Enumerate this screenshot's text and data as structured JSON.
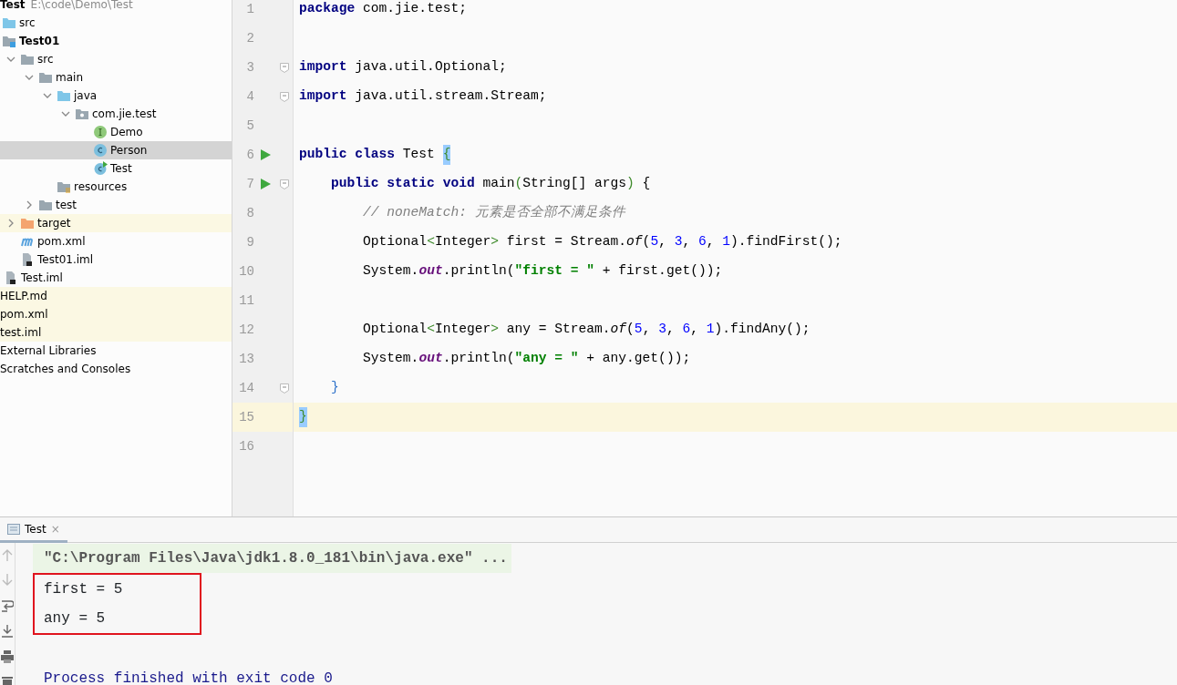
{
  "project_tree": {
    "root": {
      "label": "Test",
      "path": "E:\\code\\Demo\\Test"
    },
    "items": [
      {
        "label": "src",
        "kind": "source-folder",
        "bold": false,
        "selected": false,
        "ignored": false
      },
      {
        "label": "Test01",
        "kind": "module",
        "bold": true,
        "selected": false,
        "ignored": false,
        "children": [
          {
            "label": "src",
            "kind": "folder",
            "bold": false,
            "selected": false,
            "ignored": false,
            "expanded": true,
            "children": [
              {
                "label": "main",
                "kind": "folder",
                "bold": false,
                "selected": false,
                "ignored": false,
                "expanded": true,
                "children": [
                  {
                    "label": "java",
                    "kind": "source-folder",
                    "bold": false,
                    "selected": false,
                    "ignored": false,
                    "expanded": true,
                    "children": [
                      {
                        "label": "com.jie.test",
                        "kind": "package",
                        "bold": false,
                        "selected": false,
                        "ignored": false,
                        "expanded": true,
                        "children": [
                          {
                            "label": "Demo",
                            "kind": "interface",
                            "bold": false,
                            "selected": false,
                            "ignored": false
                          },
                          {
                            "label": "Person",
                            "kind": "class",
                            "bold": false,
                            "selected": true,
                            "ignored": false
                          },
                          {
                            "label": "Test",
                            "kind": "runnable-class",
                            "bold": false,
                            "selected": false,
                            "ignored": false
                          }
                        ]
                      }
                    ]
                  },
                  {
                    "label": "resources",
                    "kind": "resources",
                    "bold": false,
                    "selected": false,
                    "ignored": false
                  }
                ]
              },
              {
                "label": "test",
                "kind": "folder",
                "bold": false,
                "selected": false,
                "ignored": false,
                "expanded": false
              }
            ]
          },
          {
            "label": "target",
            "kind": "excluded-folder",
            "bold": false,
            "selected": false,
            "ignored": true,
            "expanded": false
          },
          {
            "label": "pom.xml",
            "kind": "maven",
            "bold": false,
            "selected": false,
            "ignored": false
          },
          {
            "label": "Test01.iml",
            "kind": "iml",
            "bold": false,
            "selected": false,
            "ignored": false
          }
        ]
      },
      {
        "label": "Test.iml",
        "kind": "iml",
        "bold": false,
        "selected": false,
        "ignored": false
      },
      {
        "label": "HELP.md",
        "kind": "file",
        "bold": false,
        "selected": false,
        "ignored": true
      },
      {
        "label": "pom.xml",
        "kind": "file",
        "bold": false,
        "selected": false,
        "ignored": true
      },
      {
        "label": "test.iml",
        "kind": "file",
        "bold": false,
        "selected": false,
        "ignored": true
      },
      {
        "label": "External Libraries",
        "kind": "file",
        "bold": false,
        "selected": false,
        "ignored": false
      },
      {
        "label": "Scratches and Consoles",
        "kind": "file",
        "bold": false,
        "selected": false,
        "ignored": false
      }
    ]
  },
  "editor": {
    "lines": [
      {
        "number": "1",
        "current": false,
        "run": false,
        "fold": false,
        "tokens": [
          {
            "kind": "kw",
            "text": "package"
          },
          {
            "kind": "plain",
            "text": " com.jie.test;"
          }
        ]
      },
      {
        "number": "2",
        "current": false,
        "run": false,
        "fold": false
      },
      {
        "number": "3",
        "current": false,
        "run": false,
        "fold": true,
        "tokens": [
          {
            "kind": "kw",
            "text": "import"
          },
          {
            "kind": "plain",
            "text": " java.util.Optional;"
          }
        ]
      },
      {
        "number": "4",
        "current": false,
        "run": false,
        "fold": true,
        "tokens": [
          {
            "kind": "kw",
            "text": "import"
          },
          {
            "kind": "plain",
            "text": " java.util.stream.Stream;"
          }
        ]
      },
      {
        "number": "5",
        "current": false,
        "run": false,
        "fold": false
      },
      {
        "number": "6",
        "current": false,
        "run": true,
        "fold": false,
        "tokens": [
          {
            "kind": "kw",
            "text": "public class"
          },
          {
            "kind": "plain",
            "text": " Test "
          },
          {
            "kind": "brace",
            "text": "{",
            "matched": true
          }
        ]
      },
      {
        "number": "7",
        "current": false,
        "run": true,
        "fold": true,
        "tokens": [
          {
            "kind": "kw",
            "text": "    public static void"
          },
          {
            "kind": "plain",
            "text": " main"
          },
          {
            "kind": "brace",
            "text": "(",
            "matched": false
          },
          {
            "kind": "plain",
            "text": "String[] args"
          },
          {
            "kind": "brace",
            "text": ")",
            "matched": false
          },
          {
            "kind": "plain",
            "text": " {"
          }
        ]
      },
      {
        "number": "8",
        "current": false,
        "run": false,
        "fold": false,
        "tokens": [
          {
            "kind": "comment",
            "text": "        // noneMatch: 元素是否全部不满足条件"
          }
        ]
      },
      {
        "number": "9",
        "current": false,
        "run": false,
        "fold": false,
        "tokens": [
          {
            "kind": "plain",
            "text": "        Optional"
          },
          {
            "kind": "brace",
            "text": "<",
            "matched": false
          },
          {
            "kind": "plain",
            "text": "Integer"
          },
          {
            "kind": "brace",
            "text": ">",
            "matched": false
          },
          {
            "kind": "plain",
            "text": " first = Stream."
          },
          {
            "kind": "method",
            "text": "of"
          },
          {
            "kind": "plain",
            "text": "("
          },
          {
            "kind": "num",
            "text": "5"
          },
          {
            "kind": "plain",
            "text": ", "
          },
          {
            "kind": "num",
            "text": "3"
          },
          {
            "kind": "plain",
            "text": ", "
          },
          {
            "kind": "num",
            "text": "6"
          },
          {
            "kind": "plain",
            "text": ", "
          },
          {
            "kind": "num",
            "text": "1"
          },
          {
            "kind": "plain",
            "text": ").findFirst();"
          }
        ]
      },
      {
        "number": "10",
        "current": false,
        "run": false,
        "fold": false,
        "tokens": [
          {
            "kind": "plain",
            "text": "        System."
          },
          {
            "kind": "field",
            "text": "out"
          },
          {
            "kind": "plain",
            "text": ".println("
          },
          {
            "kind": "str",
            "text": "\"first = \""
          },
          {
            "kind": "plain",
            "text": " + first.get());"
          }
        ]
      },
      {
        "number": "11",
        "current": false,
        "run": false,
        "fold": false
      },
      {
        "number": "12",
        "current": false,
        "run": false,
        "fold": false,
        "tokens": [
          {
            "kind": "plain",
            "text": "        Optional"
          },
          {
            "kind": "brace",
            "text": "<",
            "matched": false
          },
          {
            "kind": "plain",
            "text": "Integer"
          },
          {
            "kind": "brace",
            "text": ">",
            "matched": false
          },
          {
            "kind": "plain",
            "text": " any = Stream."
          },
          {
            "kind": "method",
            "text": "of"
          },
          {
            "kind": "plain",
            "text": "("
          },
          {
            "kind": "num",
            "text": "5"
          },
          {
            "kind": "plain",
            "text": ", "
          },
          {
            "kind": "num",
            "text": "3"
          },
          {
            "kind": "plain",
            "text": ", "
          },
          {
            "kind": "num",
            "text": "6"
          },
          {
            "kind": "plain",
            "text": ", "
          },
          {
            "kind": "num",
            "text": "1"
          },
          {
            "kind": "plain",
            "text": ").findAny();"
          }
        ]
      },
      {
        "number": "13",
        "current": false,
        "run": false,
        "fold": false,
        "tokens": [
          {
            "kind": "plain",
            "text": "        System."
          },
          {
            "kind": "field",
            "text": "out"
          },
          {
            "kind": "plain",
            "text": ".println("
          },
          {
            "kind": "str",
            "text": "\"any = \""
          },
          {
            "kind": "plain",
            "text": " + any.get());"
          }
        ]
      },
      {
        "number": "14",
        "current": false,
        "run": false,
        "fold": true,
        "tokens": [
          {
            "kind": "brace2",
            "text": "    }",
            "matched": false
          }
        ]
      },
      {
        "number": "15",
        "current": true,
        "run": false,
        "fold": false,
        "tokens": [
          {
            "kind": "brace",
            "text": "}",
            "matched": true
          }
        ]
      },
      {
        "number": "16",
        "current": false,
        "run": false,
        "fold": false
      }
    ]
  },
  "run_panel": {
    "tab": {
      "label": "Test",
      "close": "×"
    },
    "console": [
      {
        "kind": "command",
        "text": "\"C:\\Program Files\\Java\\jdk1.8.0_181\\bin\\java.exe\" ...",
        "boxed": false
      },
      {
        "kind": "output",
        "text": "first = 5",
        "boxed": true
      },
      {
        "kind": "output",
        "text": "any = 5",
        "boxed": true
      },
      {
        "kind": "blank"
      },
      {
        "kind": "system",
        "text": "Process finished with exit code 0",
        "boxed": false
      }
    ]
  }
}
